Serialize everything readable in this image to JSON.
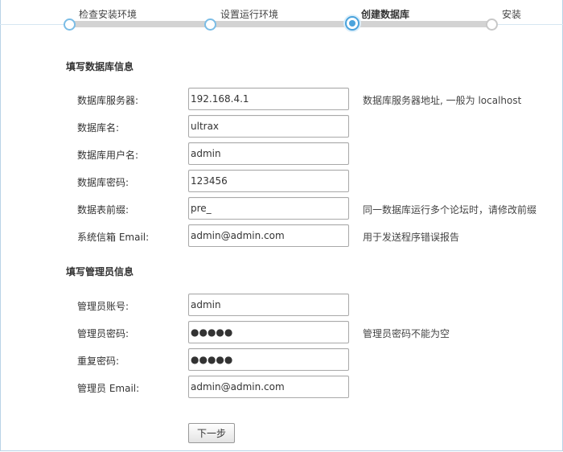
{
  "steps": [
    {
      "label": "检查安装环境",
      "state": "done"
    },
    {
      "label": "设置运行环境",
      "state": "done"
    },
    {
      "label": "创建数据库",
      "state": "current"
    },
    {
      "label": "安装",
      "state": "todo"
    }
  ],
  "db_section": {
    "title": "填写数据库信息",
    "fields": [
      {
        "label": "数据库服务器:",
        "value": "192.168.4.1",
        "hint": "数据库服务器地址, 一般为 localhost"
      },
      {
        "label": "数据库名:",
        "value": "ultrax",
        "hint": ""
      },
      {
        "label": "数据库用户名:",
        "value": "admin",
        "hint": ""
      },
      {
        "label": "数据库密码:",
        "value": "123456",
        "hint": ""
      },
      {
        "label": "数据表前缀:",
        "value": "pre_",
        "hint": "同一数据库运行多个论坛时，请修改前缀"
      },
      {
        "label": "系统信箱 Email:",
        "value": "admin@admin.com",
        "hint": "用于发送程序错误报告"
      }
    ]
  },
  "admin_section": {
    "title": "填写管理员信息",
    "fields": [
      {
        "label": "管理员账号:",
        "value": "admin",
        "hint": ""
      },
      {
        "label": "管理员密码:",
        "value": "●●●●●",
        "hint": "管理员密码不能为空"
      },
      {
        "label": "重复密码:",
        "value": "●●●●●",
        "hint": ""
      },
      {
        "label": "管理员 Email:",
        "value": "admin@admin.com",
        "hint": ""
      }
    ]
  },
  "next_button": "下一步"
}
